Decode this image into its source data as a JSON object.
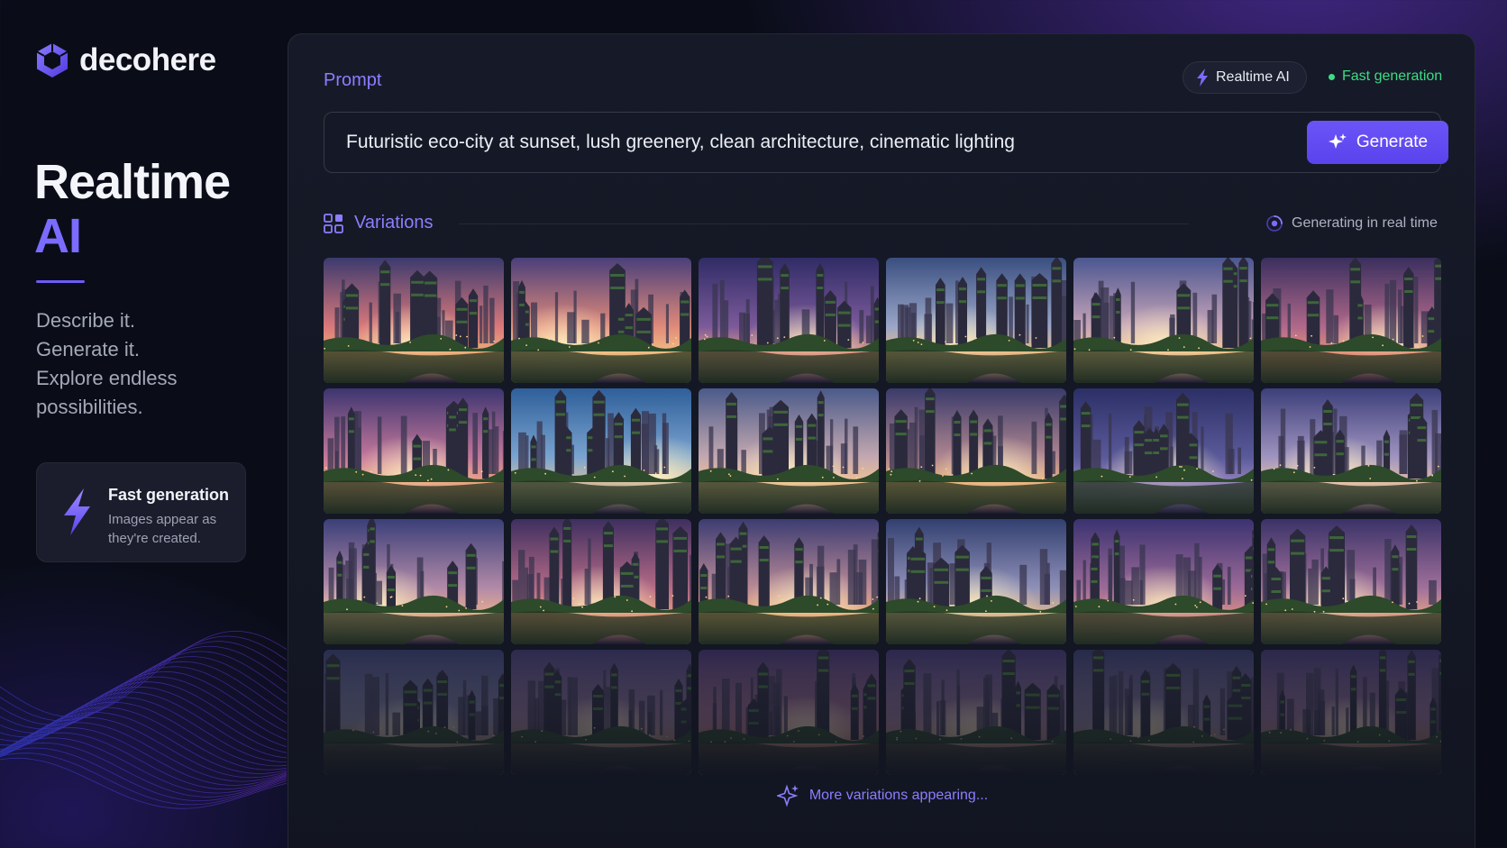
{
  "brand": {
    "name": "decohere"
  },
  "hero": {
    "line1": "Realtime",
    "line2": "AI"
  },
  "tagline": [
    "Describe it.",
    "Generate it.",
    "Explore endless",
    "possibilities."
  ],
  "feature_card": {
    "title": "Fast generation",
    "description": "Images appear as they're created."
  },
  "panel": {
    "prompt_label": "Prompt",
    "badge_realtime": "Realtime AI",
    "fast_status": "Fast generation",
    "prompt_value": "Futuristic eco-city at sunset, lush greenery, clean architecture, cinematic lighting",
    "generate_label": "Generate",
    "variations_label": "Variations",
    "generating_status": "Generating in real time",
    "more_label": "More variations appearing..."
  },
  "colors": {
    "accent": "#7b6cff",
    "button": "#5e48f0",
    "status_green": "#3ddc84"
  },
  "icons": [
    "logo-hexagon-icon",
    "lightning-bolt-icon",
    "sparkle-icon",
    "grid-icon",
    "spinner-icon"
  ],
  "tiles": [
    {
      "sky": [
        "#3b3a6e",
        "#d9787a",
        "#f2b07a"
      ],
      "sun": 0.5,
      "faded": false
    },
    {
      "sky": [
        "#4a3f7a",
        "#e08a7a",
        "#f5c184"
      ],
      "sun": 0.3,
      "faded": false
    },
    {
      "sky": [
        "#2f2c66",
        "#7c5a9a",
        "#e39a84"
      ],
      "sun": 0.6,
      "faded": false
    },
    {
      "sky": [
        "#3a4f80",
        "#9aa6c8",
        "#f0c08a"
      ],
      "sun": 0.4,
      "faded": false
    },
    {
      "sky": [
        "#4b5690",
        "#c6a4b8",
        "#f5c88e"
      ],
      "sun": 0.5,
      "faded": false
    },
    {
      "sky": [
        "#3a2f5e",
        "#b0688a",
        "#e8947a"
      ],
      "sun": 0.7,
      "faded": false
    },
    {
      "sky": [
        "#3d3570",
        "#c3779a",
        "#f1a882"
      ],
      "sun": 0.5,
      "faded": false
    },
    {
      "sky": [
        "#2f5f9a",
        "#7aa4d0",
        "#d8c0a0"
      ],
      "sun": 0.8,
      "faded": false
    },
    {
      "sky": [
        "#4a5a8a",
        "#c4a8b0",
        "#f3c592"
      ],
      "sun": 0.5,
      "faded": false
    },
    {
      "sky": [
        "#3a3b6a",
        "#b08690",
        "#f0b57c"
      ],
      "sun": 0.6,
      "faded": false
    },
    {
      "sky": [
        "#2c2f66",
        "#5a5a9a",
        "#9a88c0"
      ],
      "sun": 0.5,
      "faded": false
    },
    {
      "sky": [
        "#3c3f7a",
        "#a094c0",
        "#e8c0a8"
      ],
      "sun": 0.4,
      "faded": false
    },
    {
      "sky": [
        "#3a3f78",
        "#b28aa8",
        "#e9b08e"
      ],
      "sun": 0.3,
      "faded": false
    },
    {
      "sky": [
        "#3e2f60",
        "#b56a86",
        "#e99a7c"
      ],
      "sun": 0.5,
      "faded": false
    },
    {
      "sky": [
        "#3c3c72",
        "#b98a96",
        "#f2b27a"
      ],
      "sun": 0.6,
      "faded": false
    },
    {
      "sky": [
        "#324070",
        "#8f90b8",
        "#e2b98e"
      ],
      "sun": 0.5,
      "faded": false
    },
    {
      "sky": [
        "#3a3270",
        "#9c6a98",
        "#d88f86"
      ],
      "sun": 0.5,
      "faded": false
    },
    {
      "sky": [
        "#3a3268",
        "#a0709a",
        "#e2a088"
      ],
      "sun": 0.4,
      "faded": false
    },
    {
      "sky": [
        "#353a66",
        "#7a7a9a",
        "#c7a98e"
      ],
      "sun": 0.5,
      "faded": true
    },
    {
      "sky": [
        "#3a3565",
        "#8a7090",
        "#c89a86"
      ],
      "sun": 0.5,
      "faded": true
    },
    {
      "sky": [
        "#3b3062",
        "#9a6a88",
        "#d8907a"
      ],
      "sun": 0.6,
      "faded": true
    },
    {
      "sky": [
        "#3a3264",
        "#8d7090",
        "#d0a088"
      ],
      "sun": 0.5,
      "faded": true
    },
    {
      "sky": [
        "#333560",
        "#7a7090",
        "#c09a88"
      ],
      "sun": 0.4,
      "faded": true
    },
    {
      "sky": [
        "#383262",
        "#8a6a8c",
        "#c8927c"
      ],
      "sun": 0.5,
      "faded": true
    }
  ]
}
